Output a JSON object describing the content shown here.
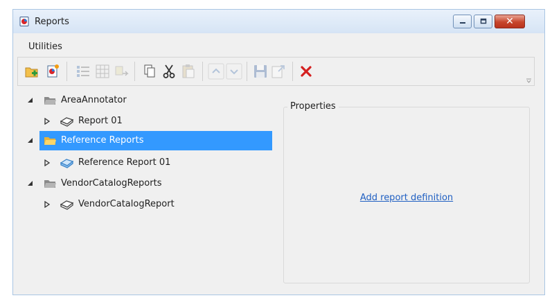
{
  "window": {
    "title": "Reports"
  },
  "window_controls": {
    "close_glyph": "✕"
  },
  "menu": {
    "items": [
      "Utilities"
    ]
  },
  "toolbar": {
    "buttons": [
      {
        "icon": "new-folder-icon",
        "enabled": true
      },
      {
        "icon": "new-report-icon",
        "enabled": true
      },
      {
        "icon": "list-view-icon",
        "enabled": false
      },
      {
        "icon": "grid-icon",
        "enabled": false
      },
      {
        "icon": "move-icon",
        "enabled": false
      },
      {
        "icon": "copy-icon",
        "enabled": true
      },
      {
        "icon": "cut-icon",
        "enabled": true
      },
      {
        "icon": "paste-icon",
        "enabled": false
      },
      {
        "icon": "move-up-icon",
        "enabled": false
      },
      {
        "icon": "move-down-icon",
        "enabled": false
      },
      {
        "icon": "save-icon",
        "enabled": false
      },
      {
        "icon": "export-icon",
        "enabled": false
      },
      {
        "icon": "delete-icon",
        "enabled": true
      }
    ]
  },
  "tree": {
    "nodes": [
      {
        "label": "AreaAnnotator",
        "level": 0,
        "expanded": true,
        "icon": "folder-icon",
        "selected": false
      },
      {
        "label": "Report 01",
        "level": 1,
        "expanded": false,
        "icon": "report-icon",
        "selected": false
      },
      {
        "label": "Reference Reports",
        "level": 0,
        "expanded": true,
        "icon": "folder-icon",
        "selected": true
      },
      {
        "label": "Reference Report 01",
        "level": 1,
        "expanded": false,
        "icon": "reference-report-icon",
        "selected": false
      },
      {
        "label": "VendorCatalogReports",
        "level": 0,
        "expanded": true,
        "icon": "folder-icon",
        "selected": false
      },
      {
        "label": "VendorCatalogReport",
        "level": 1,
        "expanded": false,
        "icon": "report-icon",
        "selected": false
      }
    ]
  },
  "properties": {
    "title": "Properties",
    "link_text": "Add report definition"
  },
  "colors": {
    "selection": "#3399ff",
    "link": "#1f5fc2",
    "delete": "#d42020",
    "window_bg": "#f0f0f0"
  }
}
